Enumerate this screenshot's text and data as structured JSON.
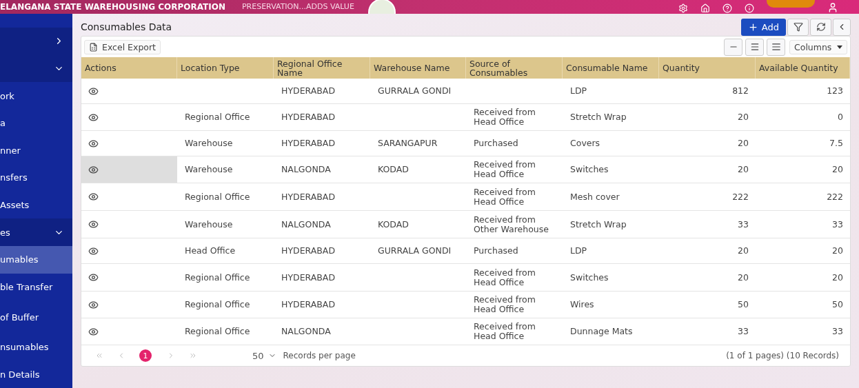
{
  "header": {
    "title": "ELANGANA STATE WAREHOUSING CORPORATION",
    "tagline": "PRESERVATION...ADDS VALUE"
  },
  "sidebar": {
    "items": [
      {
        "kind": "group",
        "expanded": false,
        "selected": false
      },
      {
        "kind": "group",
        "expanded": true,
        "selected": false
      },
      {
        "label": "ork",
        "kind": "item",
        "selected": false
      },
      {
        "label": "a",
        "kind": "item",
        "selected": false
      },
      {
        "label": "nner",
        "kind": "item",
        "selected": false
      },
      {
        "label": "nsfers",
        "kind": "item",
        "selected": false
      },
      {
        "label": "Assets",
        "kind": "item",
        "selected": false
      },
      {
        "label": "es",
        "kind": "group",
        "expanded": true,
        "selected": false
      },
      {
        "label": "umables",
        "kind": "item",
        "selected": true
      },
      {
        "label": "ble Transfer",
        "kind": "item",
        "selected": false
      },
      {
        "label": "of Buffer",
        "kind": "item",
        "selected": false
      },
      {
        "label": "nsumables",
        "kind": "item",
        "selected": false
      },
      {
        "label": "n Details",
        "kind": "item",
        "selected": false
      }
    ]
  },
  "page": {
    "title": "Consumables Data",
    "add_button": "Add",
    "export_button": "Excel Export",
    "columns_button": "Columns"
  },
  "table": {
    "actions_header": "Actions",
    "columns": [
      "Location Type",
      "Regional Office Name",
      "Warehouse Name",
      "Source of Consumables",
      "Consumable Name",
      "Quantity",
      "Available Quantity"
    ],
    "rows": [
      {
        "hovered": false,
        "cells": [
          "",
          "HYDERABAD",
          "GURRALA GONDI",
          "",
          "LDP",
          "812",
          "123"
        ]
      },
      {
        "hovered": false,
        "cells": [
          "Regional Office",
          "HYDERABAD",
          "",
          "Received from Head Office",
          "Stretch Wrap",
          "20",
          "0"
        ]
      },
      {
        "hovered": false,
        "cells": [
          "Warehouse",
          "HYDERABAD",
          "SARANGAPUR",
          "Purchased",
          "Covers",
          "20",
          "7.5"
        ]
      },
      {
        "hovered": true,
        "cells": [
          "Warehouse",
          "NALGONDA",
          "KODAD",
          "Received from Head Office",
          "Switches",
          "20",
          "20"
        ]
      },
      {
        "hovered": false,
        "cells": [
          "Regional Office",
          "HYDERABAD",
          "",
          "Received from Head Office",
          "Mesh cover",
          "222",
          "222"
        ]
      },
      {
        "hovered": false,
        "cells": [
          "Warehouse",
          "NALGONDA",
          "KODAD",
          "Received from Other Warehouse",
          "Stretch Wrap",
          "33",
          "33"
        ]
      },
      {
        "hovered": false,
        "cells": [
          "Head Office",
          "HYDERABAD",
          "GURRALA GONDI",
          "Purchased",
          "LDP",
          "20",
          "20"
        ]
      },
      {
        "hovered": false,
        "cells": [
          "Regional Office",
          "HYDERABAD",
          "",
          "Received from Head Office",
          "Switches",
          "20",
          "20"
        ]
      },
      {
        "hovered": false,
        "cells": [
          "Regional Office",
          "HYDERABAD",
          "",
          "Received from Head Office",
          "Wires",
          "50",
          "50"
        ]
      },
      {
        "hovered": false,
        "cells": [
          "Regional Office",
          "NALGONDA",
          "",
          "Received from Head Office",
          "Dunnage Mats",
          "33",
          "33"
        ]
      }
    ]
  },
  "pagination": {
    "pages": [
      {
        "label": "1",
        "selected": true
      }
    ],
    "page_size": "50",
    "page_size_label": "Records per page",
    "summary": "(1 of 1 pages) (10 Records)"
  }
}
